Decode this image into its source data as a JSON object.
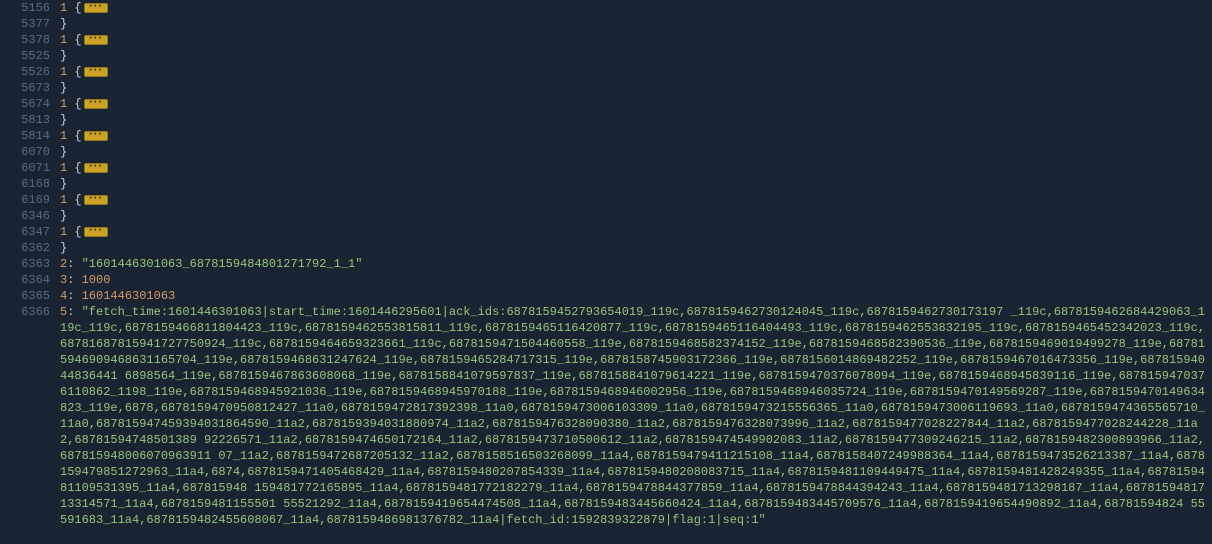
{
  "lines": [
    {
      "ln": "5156",
      "kind": "fold-open",
      "prefix": "1"
    },
    {
      "ln": "5377",
      "kind": "close-brace"
    },
    {
      "ln": "5378",
      "kind": "fold-open",
      "prefix": "1"
    },
    {
      "ln": "5525",
      "kind": "close-brace"
    },
    {
      "ln": "5526",
      "kind": "fold-open",
      "prefix": "1"
    },
    {
      "ln": "5673",
      "kind": "close-brace"
    },
    {
      "ln": "5674",
      "kind": "fold-open",
      "prefix": "1"
    },
    {
      "ln": "5813",
      "kind": "close-brace"
    },
    {
      "ln": "5814",
      "kind": "fold-open",
      "prefix": "1"
    },
    {
      "ln": "6070",
      "kind": "close-brace"
    },
    {
      "ln": "6071",
      "kind": "fold-open",
      "prefix": "1"
    },
    {
      "ln": "6168",
      "kind": "close-brace"
    },
    {
      "ln": "6169",
      "kind": "fold-open",
      "prefix": "1"
    },
    {
      "ln": "6346",
      "kind": "close-brace"
    },
    {
      "ln": "6347",
      "kind": "fold-open",
      "prefix": "1"
    },
    {
      "ln": "6362",
      "kind": "close-brace"
    },
    {
      "ln": "6363",
      "kind": "kv-str",
      "key": "2",
      "val": "\"1601446301063_6878159484801271792_1_1\""
    },
    {
      "ln": "6364",
      "kind": "kv-num",
      "key": "3",
      "val": "1000"
    },
    {
      "ln": "6365",
      "kind": "kv-num",
      "key": "4",
      "val": "1601446301063"
    },
    {
      "ln": "6366",
      "kind": "kv-str-wrap",
      "key": "5",
      "val": "\"fetch_time:1601446301063|start_time:1601446295601|ack_ids:6878159452793654019_119c,6878159462730124045_119c,6878159462730173197 _119c,6878159462684429063_119c_119c,6878159466811804423_119c,6878159462553815811_119c,6878159465116420877_119c,6878159465116404493_119c,6878159462553832195_119c,6878159465452342023_119c,68781687815941727750924_119c,6878159464659323661_119c,6878159471504460558_119e,6878159468582374152_119e,6878159468582390536_119e,6878159469019499278_119e,687815946909468631165704_119e,6878159468631247624_119e,6878159465284717315_119e,6878158745903172366_119e,6878156014869482252_119e,6878159467016473356_119e,68781594044836441 6898564_119e,6878159467863608068_119e,6878158841079597837_119e,6878158841079614221_119e,6878159470376078094_119e,6878159468945839116_119e,6878159470376110862_1198_119e,6878159468945921036_119e,6878159468945970188_119e,6878159468946002956_119e,6878159468946035724_119e,6878159470149569287_119e,6878159470149634823_119e,6878,6878159470950812427_11a0,6878159472817392398_11a0,6878159473006103309_11a0,6878159473215556365_11a0,6878159473006119693_11a0,6878159474365565710_11a0,687815947459394031864590_11a2,6878159394031880974_11a2,6878159476328090380_11a2,6878159476328073996_11a2,6878159477028227844_11a2,6878159477028244228_11a2,68781594748501389 92226571_11a2,6878159474650172164_11a2,6878159473710500612_11a2,6878159474549902083_11a2,6878159477309246215_11a2,6878159482300893966_11a2,687815948006070963911 07_11a2,6878159472687205132_11a2,6878158516503268099_11a4,6878159479411215108_11a4,6878158407249988364_11a4,6878159473526213387_11a4,6878159479851272963_11a4,6874,6878159471405468429_11a4,6878159480207854339_11a4,6878159480208083715_11a4,6878159481109449475_11a4,6878159481428249355_11a4,6878159481109531395_11a4,687815948 159481772165895_11a4,6878159481772182279_11a4,6878159478844377859_11a4,6878159478844394243_11a4,6878159481713298187_11a4,6878159481713314571_11a4,6878159481155501 55521292_11a4,6878159419654474508_11a4,6878159483445660424_11a4,6878159483445709576_11a4,6878159419654490892_11a4,68781594824 55591683_11a4,6878159482455608067_11a4,6878159486981376782_11a4|fetch_id:1592839322879|flag:1|seq:1\""
    }
  ]
}
